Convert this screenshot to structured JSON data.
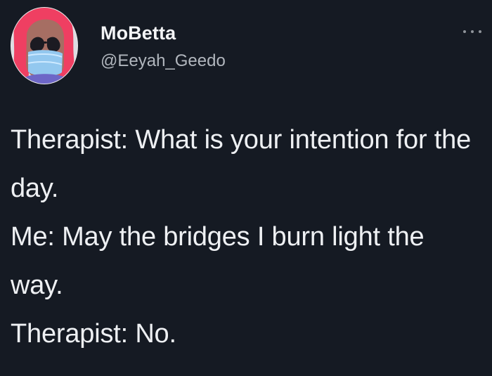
{
  "author": {
    "display_name": "MoBetta",
    "handle": "@Eeyah_Geedo",
    "avatar_icon": "avatar-photo"
  },
  "tweet": {
    "lines": [
      "Therapist: What is your intention for the day.",
      "Me: May the bridges I burn light the way.",
      "Therapist: No."
    ]
  },
  "colors": {
    "background": "#151a23",
    "text_primary": "#eef0f3",
    "text_secondary": "#b1b6bd"
  },
  "icons": {
    "more": "more-options-icon"
  }
}
